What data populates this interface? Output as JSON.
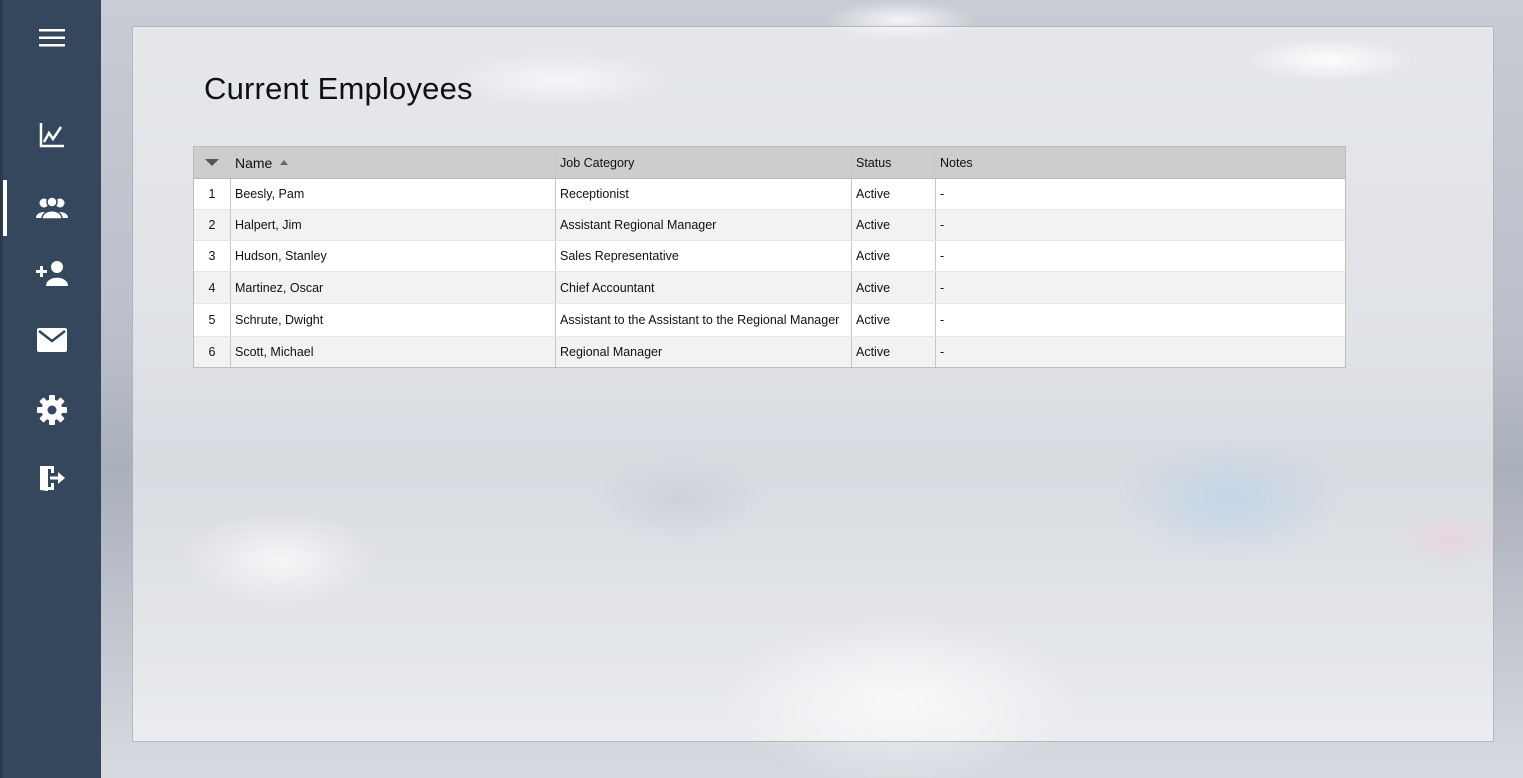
{
  "sidebar": {
    "items": [
      {
        "icon": "hamburger-menu-icon"
      },
      {
        "icon": "line-chart-icon"
      },
      {
        "icon": "people-group-icon",
        "active": true
      },
      {
        "icon": "add-user-icon"
      },
      {
        "icon": "envelope-icon"
      },
      {
        "icon": "gear-icon"
      },
      {
        "icon": "logout-door-icon"
      }
    ],
    "bg_color": "#34475c"
  },
  "main": {
    "title": "Current Employees"
  },
  "table": {
    "columns": [
      "Name",
      "Job Category",
      "Status",
      "Notes"
    ],
    "sorted_column": "Name",
    "sort_direction": "ascending",
    "rows": [
      {
        "index": "1",
        "name": "Beesly, Pam",
        "job": "Receptionist",
        "status": "Active",
        "notes": "-"
      },
      {
        "index": "2",
        "name": "Halpert, Jim",
        "job": "Assistant Regional Manager",
        "status": "Active",
        "notes": "-"
      },
      {
        "index": "3",
        "name": "Hudson, Stanley",
        "job": "Sales Representative",
        "status": "Active",
        "notes": "-"
      },
      {
        "index": "4",
        "name": "Martinez, Oscar",
        "job": "Chief Accountant",
        "status": "Active",
        "notes": "-"
      },
      {
        "index": "5",
        "name": "Schrute, Dwight",
        "job": "Assistant to the Assistant to the Regional Manager",
        "status": "Active",
        "notes": "-"
      },
      {
        "index": "6",
        "name": "Scott, Michael",
        "job": "Regional Manager",
        "status": "Active",
        "notes": "-"
      }
    ]
  }
}
